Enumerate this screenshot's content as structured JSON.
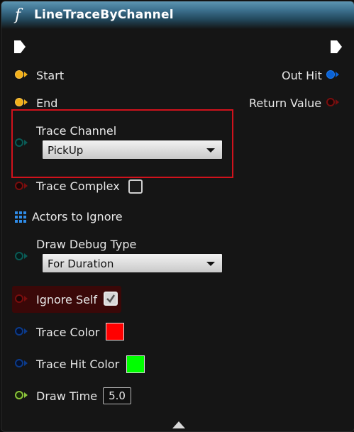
{
  "node": {
    "function_icon": "f",
    "title": "LineTraceByChannel",
    "inputs": {
      "start": "Start",
      "end": "End",
      "trace_channel": {
        "label": "Trace Channel",
        "value": "PickUp"
      },
      "trace_complex": {
        "label": "Trace Complex",
        "checked": false
      },
      "actors_to_ignore": "Actors to Ignore",
      "draw_debug_type": {
        "label": "Draw Debug Type",
        "value": "For Duration"
      },
      "ignore_self": {
        "label": "Ignore Self",
        "checked": true
      },
      "trace_color": {
        "label": "Trace Color",
        "color": "#ff0000"
      },
      "trace_hit_color": {
        "label": "Trace Hit Color",
        "color": "#00ff00"
      },
      "draw_time": {
        "label": "Draw Time",
        "value": "5.0"
      }
    },
    "outputs": {
      "out_hit": "Out Hit",
      "return_value": "Return Value"
    }
  },
  "colors": {
    "header": "#3e7290",
    "highlight_border": "#d0121c",
    "pin_vector": "#f2b019",
    "pin_struct": "#0a62d6",
    "pin_bool": "#7a0e0e",
    "pin_enum": "#0a5a55",
    "pin_float": "#8ac43a"
  }
}
